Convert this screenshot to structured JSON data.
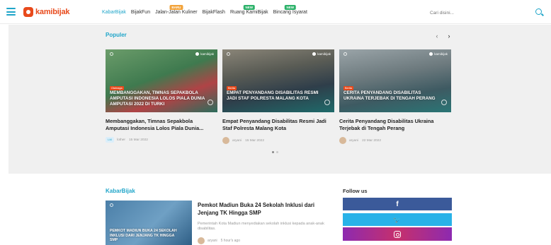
{
  "header": {
    "logo_text": "kamibijak",
    "nav": [
      {
        "label": "KabarBijak",
        "active": true
      },
      {
        "label": "BijakFun"
      },
      {
        "label": "Jalan-Jalan Kuliner",
        "badge": "BARU"
      },
      {
        "label": "BijakFlash"
      },
      {
        "label": "Ruang KamiBijak",
        "badge": "NEW"
      },
      {
        "label": "Bincang Isyarat",
        "badge": "NEW"
      }
    ],
    "search_placeholder": "Cari disini..."
  },
  "popular": {
    "title": "Populer",
    "cards": [
      {
        "thumb_caption": "MEMBANGGAKAN, TIMNAS SEPAKBOLA AMPUTASI INDONESIA LOLOS PIALA DUNIA AMPUTASI 2022 DI TURKI",
        "thumb_brand": "kamibijak",
        "thumb_tag": "Olahraga",
        "title": "Membanggakan, Timnas Sepakbola Amputasi Indonesia Lolos Piala Dunia...",
        "author_badge": "LM",
        "author": "lother",
        "date": "15 Mar 2022"
      },
      {
        "thumb_caption": "EMPAT PENYANDANG DISABILITAS RESMI JADI STAF POLRESTA MALANG KOTA",
        "thumb_brand": "kamibijak",
        "thumb_tag": "Berita",
        "title": "Empat Penyandang Disabilitas Resmi Jadi Staf Polresta Malang Kota",
        "author": "aryani",
        "date": "15 Mar 2022"
      },
      {
        "thumb_caption": "CERITA PENYANDANG DISABILITAS UKRAINA TERJEBAK DI TENGAH PERANG",
        "thumb_brand": "kamibijak",
        "thumb_tag": "Berita",
        "title": "Cerita Penyandang Disabilitas Ukraina Terjebak di Tengah Perang",
        "author": "aryani",
        "date": "22 Mar 2022"
      }
    ]
  },
  "kabarbijak": {
    "title": "KabarBijak",
    "thumb_caption": "PEMKOT MADIUN BUKA 24 SEKOLAH INKLUSI DARI JENJANG TK HINGGA SMP",
    "headline": "Pemkot Madiun Buka 24 Sekolah Inklusi dari Jenjang TK Hingga SMP",
    "excerpt": "Pemerintah Kota Madiun menyediakan sekolah inklusi kepada anak-anak disabilitas.",
    "author": "aryani",
    "time": "5 hour's ago"
  },
  "follow": {
    "title": "Follow us",
    "facebook": "f",
    "twitter": "🐦"
  },
  "colors": {
    "accent": "#1fa5c9",
    "brand": "#e84a1c"
  }
}
